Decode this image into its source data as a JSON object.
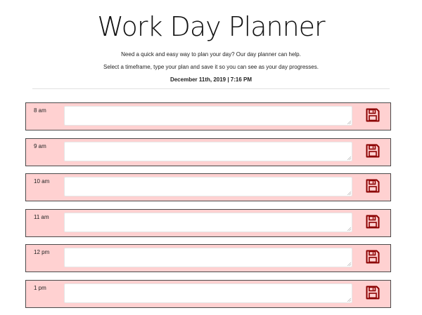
{
  "header": {
    "title": "Work Day Planner",
    "lead_line1": "Need a quick and easy way to plan your day? Our day planner can help.",
    "lead_line2": "Select a timeframe, type your plan and save it so you can see as your day progresses.",
    "current_date": "December 11th, 2019 | 7:16 PM"
  },
  "colors": {
    "row_background": "#ffd1d1",
    "save_icon": "#8b0000",
    "row_border": "#4a4a4a"
  },
  "rows": [
    {
      "hour": "8 am",
      "plan": "",
      "icon": "floppy-disk-icon"
    },
    {
      "hour": "9 am",
      "plan": "",
      "icon": "floppy-disk-icon"
    },
    {
      "hour": "10 am",
      "plan": "",
      "icon": "floppy-disk-icon"
    },
    {
      "hour": "11 am",
      "plan": "",
      "icon": "floppy-disk-icon"
    },
    {
      "hour": "12 pm",
      "plan": "",
      "icon": "floppy-disk-icon"
    },
    {
      "hour": "1 pm",
      "plan": "",
      "icon": "floppy-disk-icon"
    }
  ]
}
